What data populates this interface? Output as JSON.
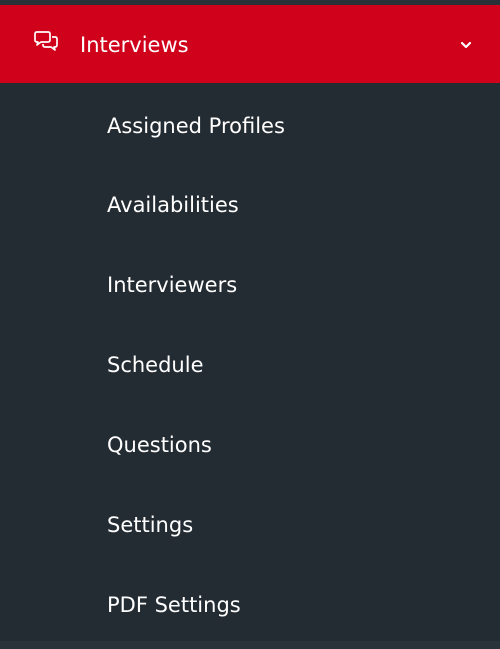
{
  "menu": {
    "header": {
      "label": "Interviews",
      "icon": "chat-bubbles-icon",
      "expand_icon": "chevron-down-icon",
      "color": "#d0021b"
    },
    "items": [
      {
        "label": "Assigned Profiles"
      },
      {
        "label": "Availabilities"
      },
      {
        "label": "Interviewers"
      },
      {
        "label": "Schedule"
      },
      {
        "label": "Questions"
      },
      {
        "label": "Settings"
      },
      {
        "label": "PDF Settings"
      }
    ]
  },
  "colors": {
    "background": "#242c33",
    "accent": "#d0021b",
    "text": "#ffffff"
  }
}
